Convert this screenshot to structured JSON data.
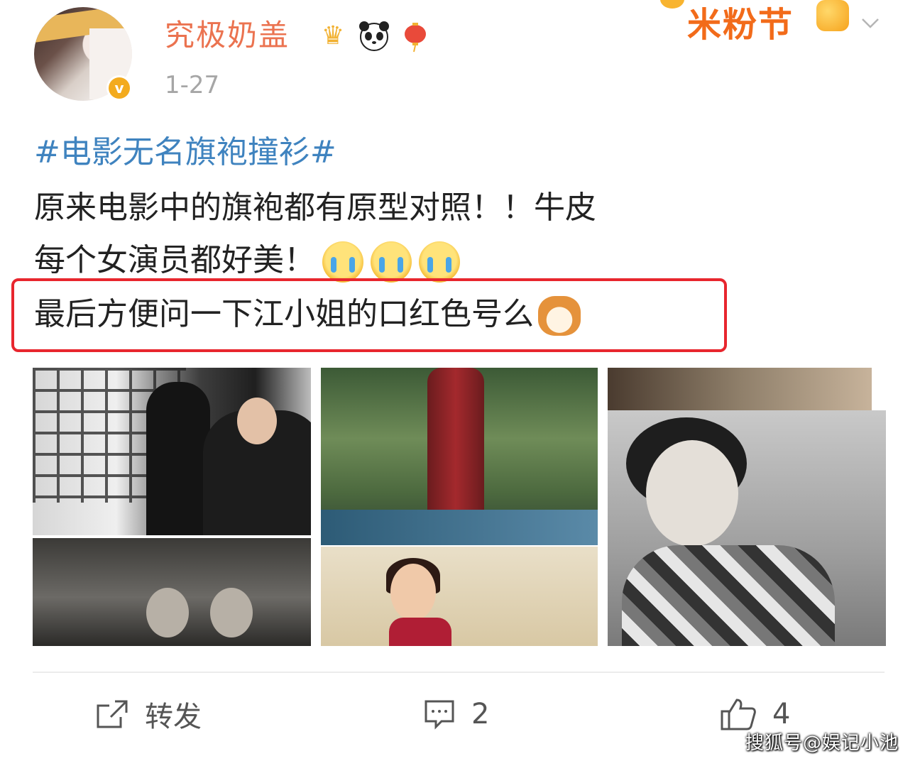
{
  "header": {
    "username": "究极奶盖",
    "time": "1-27",
    "festival_label": "米粉节",
    "badges": [
      "crown-icon",
      "panda-icon",
      "lantern-icon"
    ],
    "verified_icon": "verified-icon"
  },
  "post": {
    "hashtag": "#电影无名旗袍撞衫#",
    "line1": "原来电影中的旗袍都有原型对照！！牛皮",
    "line2": "每个女演员都好美！",
    "line3": "最后方便问一下江小姐的口红色号么",
    "emoji_line2": [
      "crying-face-icon",
      "crying-face-icon",
      "crying-face-icon"
    ],
    "emoji_line3": "cat-face-icon",
    "highlight_color": "#e8262e",
    "hashtag_color": "#3f83bf",
    "username_color": "#eb7350"
  },
  "actions": {
    "repost_label": "转发",
    "comment_count": "2",
    "like_count": "4"
  },
  "watermark": "搜狐号@娱记小池"
}
